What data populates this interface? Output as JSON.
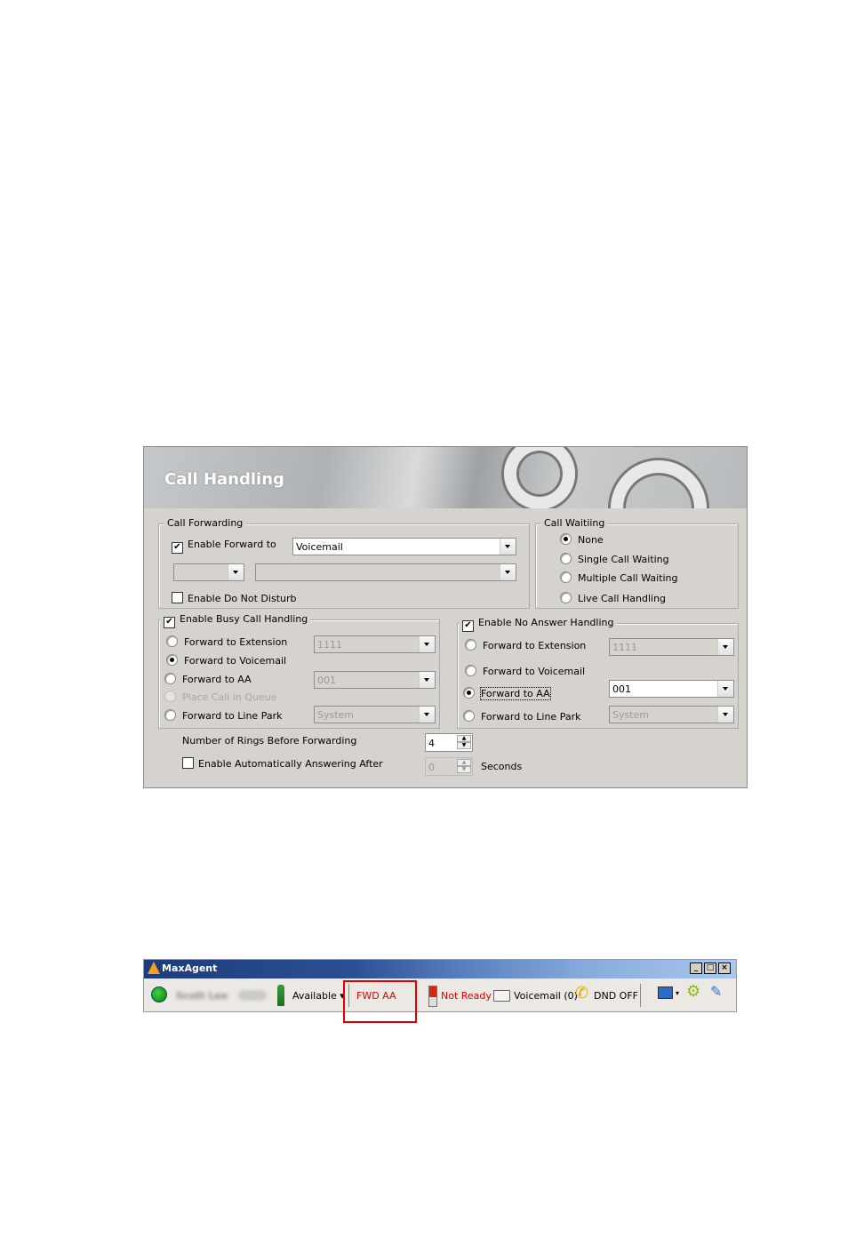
{
  "dialog": {
    "title": "Call Handling",
    "call_forwarding": {
      "legend": "Call Forwarding",
      "enable_forward_label": "Enable Forward to",
      "enable_forward_checked": true,
      "forward_target": "Voicemail",
      "sub_combo_1": "",
      "sub_combo_2": "",
      "dnd_label": "Enable Do Not Disturb",
      "dnd_checked": false
    },
    "call_waiting": {
      "legend": "Call Waitiing",
      "options": [
        "None",
        "Single Call Waiting",
        "Multiple Call Waiting",
        "Live Call Handling"
      ],
      "selected": "None"
    },
    "busy": {
      "legend": "Enable Busy Call Handling",
      "checked": true,
      "options": [
        "Forward to Extension",
        "Forward to Voicemail",
        "Forward to AA",
        "Place Call in Queue",
        "Forward to Line Park"
      ],
      "selected": "Forward to Voicemail",
      "extension_value": "1111",
      "aa_value": "001",
      "line_park_value": "System"
    },
    "no_answer": {
      "legend": "Enable No Answer Handling",
      "checked": true,
      "options": [
        "Forward to Extension",
        "Forward to Voicemail",
        "Forward to AA",
        "Forward to Line Park"
      ],
      "selected": "Forward to AA",
      "extension_value": "1111",
      "aa_value": "001",
      "line_park_value": "System"
    },
    "rings_label": "Number of Rings Before Forwarding",
    "rings_value": "4",
    "auto_answer_label": "Enable Automatically Answering After",
    "auto_answer_checked": false,
    "auto_answer_value": "0",
    "seconds_label": "Seconds"
  },
  "agent_bar": {
    "app_title": "MaxAgent",
    "user_name": "Scott Lee",
    "status": "Available",
    "forward_status": "FWD AA",
    "ready_status": "Not Ready",
    "voicemail": "Voicemail (0)",
    "dnd": "DND OFF",
    "window_buttons": [
      "_",
      "□",
      "×"
    ],
    "colors": {
      "forward_status": "#e00000",
      "ready_status": "#e00000",
      "highlight_box": "#e00000"
    }
  }
}
